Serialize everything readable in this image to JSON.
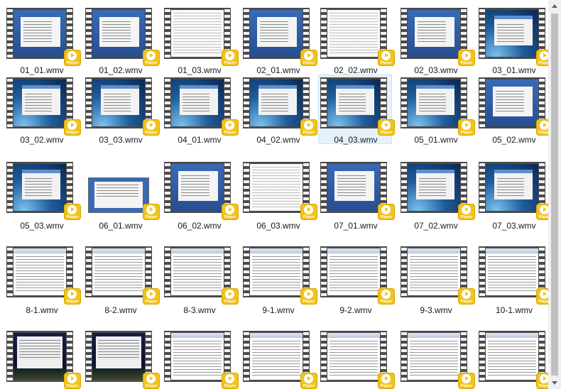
{
  "badge_label": "Player",
  "colors": {
    "selection": "#e5f1fb",
    "badge": "#f2c31a",
    "film": "#4a4a4a"
  },
  "files": [
    {
      "name": "01_01.wmv",
      "style": "blue"
    },
    {
      "name": "01_02.wmv",
      "style": "blue"
    },
    {
      "name": "01_03.wmv",
      "style": "doc"
    },
    {
      "name": "02_01.wmv",
      "style": "blue"
    },
    {
      "name": "02_02.wmv",
      "style": "doc"
    },
    {
      "name": "02_03.wmv",
      "style": "blue"
    },
    {
      "name": "03_01.wmv",
      "style": "wave"
    },
    {
      "name": "03_02.wmv",
      "style": "wave"
    },
    {
      "name": "03_03.wmv",
      "style": "wave"
    },
    {
      "name": "04_01.wmv",
      "style": "wave"
    },
    {
      "name": "04_02.wmv",
      "style": "wave"
    },
    {
      "name": "04_03.wmv",
      "style": "wave",
      "selected": true
    },
    {
      "name": "05_01.wmv",
      "style": "wave"
    },
    {
      "name": "05_02.wmv",
      "style": "blue"
    },
    {
      "name": "05_03.wmv",
      "style": "wave"
    },
    {
      "name": "06_01.wmv",
      "style": "plain"
    },
    {
      "name": "06_02.wmv",
      "style": "blue"
    },
    {
      "name": "06_03.wmv",
      "style": "doc"
    },
    {
      "name": "07_01.wmv",
      "style": "blue"
    },
    {
      "name": "07_02.wmv",
      "style": "wave"
    },
    {
      "name": "07_03.wmv",
      "style": "wave"
    },
    {
      "name": "8-1.wmv",
      "style": "app"
    },
    {
      "name": "8-2.wmv",
      "style": "app"
    },
    {
      "name": "8-3.wmv",
      "style": "app"
    },
    {
      "name": "9-1.wmv",
      "style": "app"
    },
    {
      "name": "9-2.wmv",
      "style": "app"
    },
    {
      "name": "9-3.wmv",
      "style": "app"
    },
    {
      "name": "10-1.wmv",
      "style": "app"
    },
    {
      "name": "",
      "style": "night"
    },
    {
      "name": "",
      "style": "night"
    },
    {
      "name": "",
      "style": "app"
    },
    {
      "name": "",
      "style": "app"
    },
    {
      "name": "",
      "style": "app"
    },
    {
      "name": "",
      "style": "app"
    },
    {
      "name": "",
      "style": "app"
    }
  ]
}
